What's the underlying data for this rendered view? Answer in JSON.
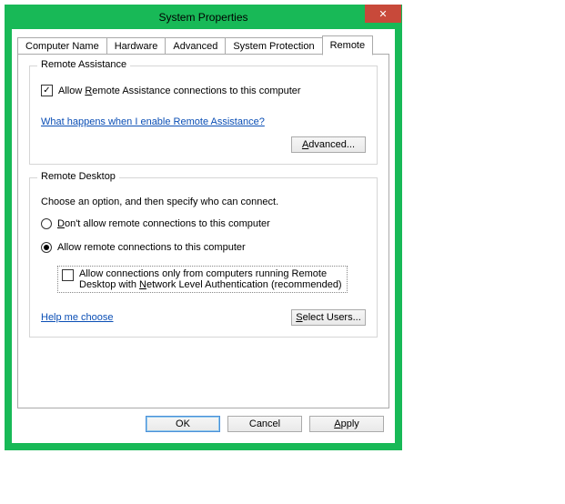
{
  "window": {
    "title": "System Properties",
    "close_glyph": "✕"
  },
  "tabs": {
    "computer_name": "Computer Name",
    "hardware": "Hardware",
    "advanced": "Advanced",
    "system_protection": "System Protection",
    "remote": "Remote"
  },
  "remote_assistance": {
    "legend": "Remote Assistance",
    "allow_pre": "Allow ",
    "allow_mnemonic": "R",
    "allow_post": "emote Assistance connections to this computer",
    "help_link": "What happens when I enable Remote Assistance?",
    "advanced_mnemonic": "A",
    "advanced_post": "dvanced..."
  },
  "remote_desktop": {
    "legend": "Remote Desktop",
    "desc": "Choose an option, and then specify who can connect.",
    "dont_pre": "D",
    "dont_post": "on't allow remote connections to this computer",
    "allow_text": "Allow remote connections to this computer",
    "nla_pre": "Allow connections only from computers running Remote Desktop with ",
    "nla_mnemonic": "N",
    "nla_post": "etwork Level Authentication (recommended)",
    "help_link": "Help me choose",
    "select_mnemonic": "S",
    "select_post": "elect Users..."
  },
  "buttons": {
    "ok": "OK",
    "cancel": "Cancel",
    "apply_mnemonic": "A",
    "apply_post": "pply"
  }
}
